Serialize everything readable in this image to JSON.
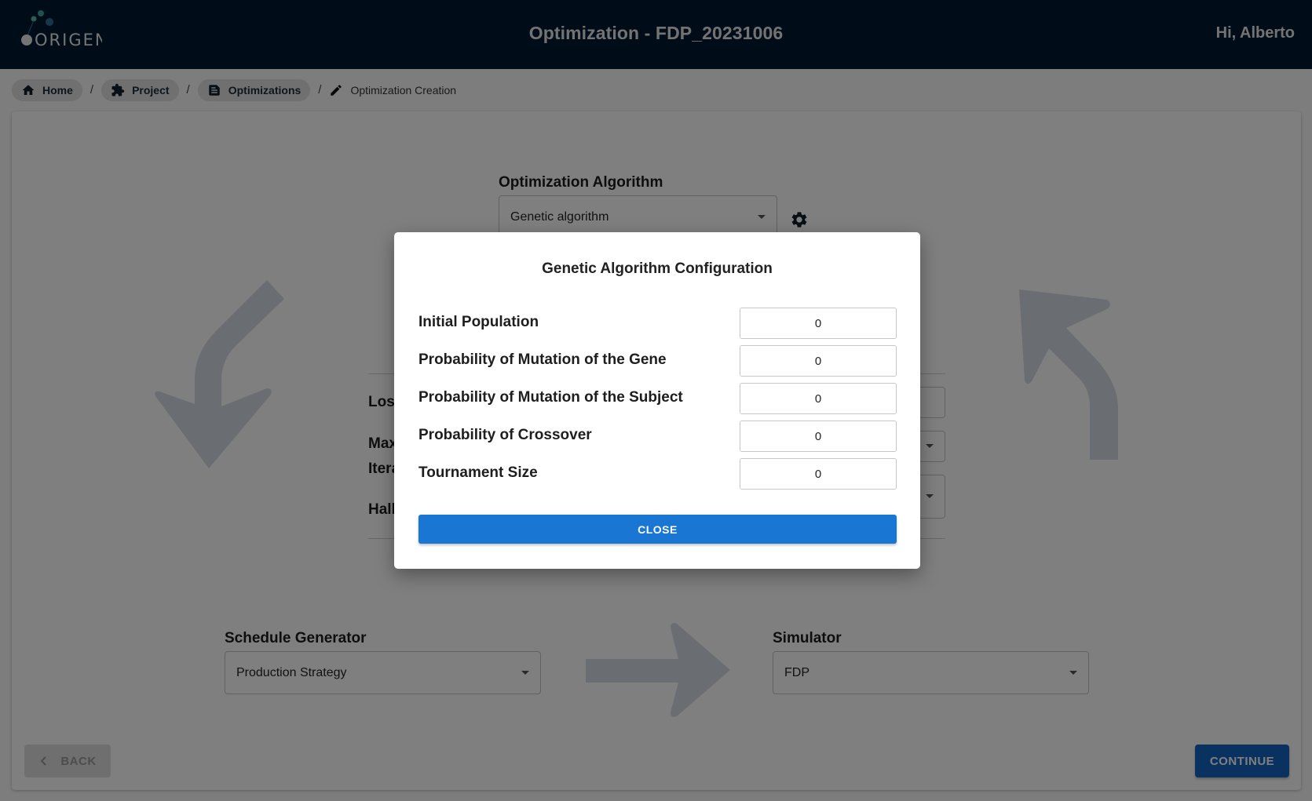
{
  "header": {
    "logo_text": "ORIGEN",
    "title": "Optimization - FDP_20231006",
    "greeting": "Hi, Alberto"
  },
  "breadcrumb": [
    {
      "label": "Home",
      "icon": "home-icon"
    },
    {
      "label": "Project",
      "icon": "puzzle-icon"
    },
    {
      "label": "Optimizations",
      "icon": "document-icon"
    },
    {
      "label": "Optimization Creation",
      "icon": "pencil-icon"
    }
  ],
  "breadcrumb_separator": "/",
  "optimization_algorithm": {
    "label": "Optimization Algorithm",
    "value": "Genetic algorithm",
    "settings_icon": "gear-icon"
  },
  "partially_hidden_fields": {
    "loss_label": "Los",
    "max_iterations_label_line1": "Max",
    "max_iterations_label_line2": "Itera",
    "hall_label": "Hall"
  },
  "schedule_generator": {
    "label": "Schedule Generator",
    "value": "Production Strategy"
  },
  "simulator": {
    "label": "Simulator",
    "value": "FDP"
  },
  "footer": {
    "back_label": "BACK",
    "continue_label": "CONTINUE"
  },
  "modal": {
    "title": "Genetic Algorithm Configuration",
    "fields": [
      {
        "label": "Initial Population",
        "value": "0"
      },
      {
        "label": "Probability of Mutation of the Gene",
        "value": "0"
      },
      {
        "label": "Probability of Mutation of the Subject",
        "value": "0"
      },
      {
        "label": "Probability of Crossover",
        "value": "0"
      },
      {
        "label": "Tournament Size",
        "value": "0"
      }
    ],
    "close_label": "CLOSE"
  },
  "colors": {
    "header_bg": "#001a33",
    "primary": "#1976d2",
    "continue": "#1565c0",
    "arrow": "#8d9ba8"
  }
}
